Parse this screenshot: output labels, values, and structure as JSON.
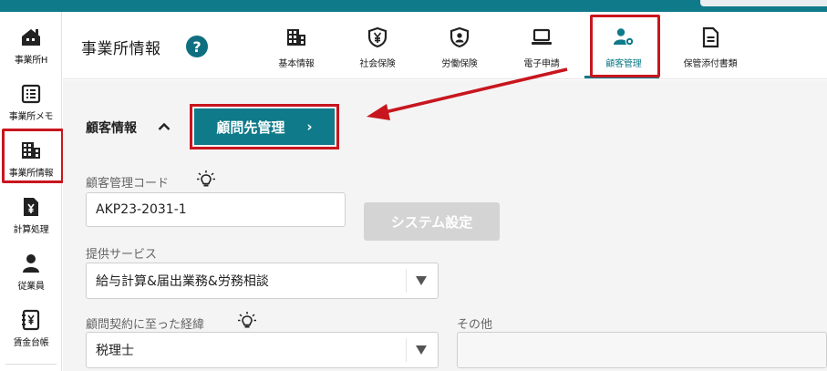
{
  "sidebar": {
    "items": [
      {
        "label": "事業所H",
        "icon": "house-icon"
      },
      {
        "label": "事業所メモ",
        "icon": "memo-list-icon"
      },
      {
        "label": "事業所情報",
        "icon": "building-icon"
      },
      {
        "label": "計算処理",
        "icon": "yen-document-icon"
      },
      {
        "label": "従業員",
        "icon": "person-icon"
      },
      {
        "label": "賃金台帳",
        "icon": "yen-ledger-icon"
      }
    ],
    "highlighted": "事業所情報"
  },
  "header": {
    "title": "事業所情報",
    "help": "?",
    "tabs": [
      {
        "label": "基本情報",
        "icon": "building-icon"
      },
      {
        "label": "社会保険",
        "icon": "yen-shield-icon"
      },
      {
        "label": "労働保険",
        "icon": "person-shield-icon"
      },
      {
        "label": "電子申請",
        "icon": "laptop-icon"
      },
      {
        "label": "顧客管理",
        "icon": "person-gear-icon",
        "active": true
      },
      {
        "label": "保管添付書類",
        "icon": "document-icon"
      }
    ]
  },
  "content": {
    "section_title": "顧客情報",
    "advisor_button": "顧問先管理",
    "customer_code_label": "顧客管理コード",
    "customer_code_value": "AKP23-2031-1",
    "system_settings_button": "システム設定",
    "service_label": "提供サービス",
    "service_value": "給与計算&届出業務&労務相談",
    "route_label": "顧問契約に至った経緯",
    "route_value": "税理士",
    "other_label": "その他",
    "other_value": ""
  },
  "colors": {
    "brand": "#0f7a8a",
    "highlight": "#c8161e",
    "disabled": "#d4d4d4"
  }
}
